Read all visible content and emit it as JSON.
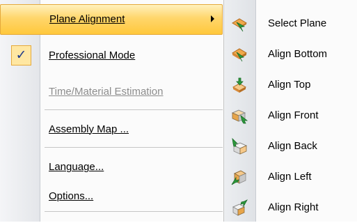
{
  "main_menu": {
    "items": [
      {
        "label": "Plane Alignment"
      },
      {
        "label": "Professional Mode"
      },
      {
        "label": "Time/Material Estimation"
      },
      {
        "label": "Assembly Map ..."
      },
      {
        "label": "Language..."
      },
      {
        "label": "Options..."
      }
    ],
    "check_mark": "✓"
  },
  "sub_menu": {
    "items": [
      {
        "label": "Select Plane",
        "icon": "select-plane-icon"
      },
      {
        "label": "Align Bottom",
        "icon": "align-bottom-icon"
      },
      {
        "label": "Align Top",
        "icon": "align-top-icon"
      },
      {
        "label": "Align Front",
        "icon": "align-front-icon"
      },
      {
        "label": "Align Back",
        "icon": "align-back-icon"
      },
      {
        "label": "Align Left",
        "icon": "align-left-icon"
      },
      {
        "label": "Align Right",
        "icon": "align-right-icon"
      }
    ]
  },
  "colors": {
    "highlight": "#ffd66b",
    "highlight_border": "#e5a93b",
    "check": "#1f3a8a",
    "disabled_text": "#8d8d8d"
  }
}
